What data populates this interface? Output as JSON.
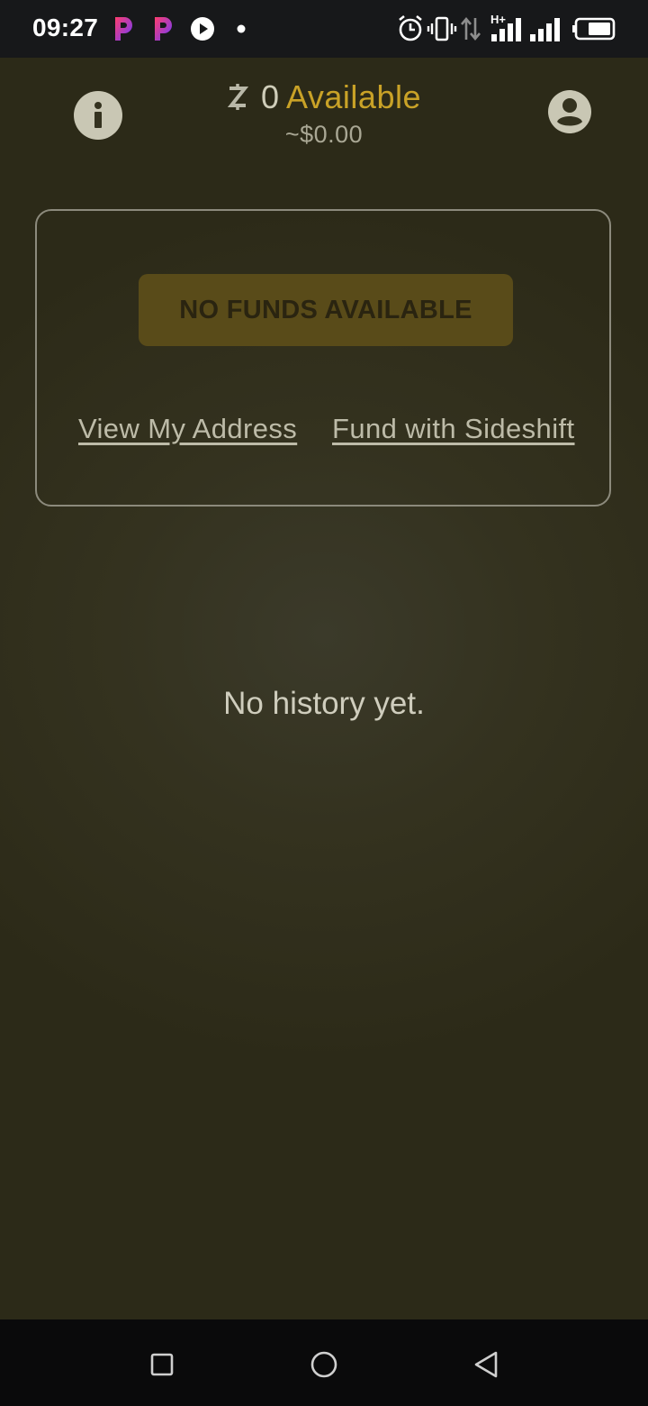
{
  "status_bar": {
    "time": "09:27",
    "network_label": "H+",
    "notification_icons": [
      "p-app-icon",
      "p-app-icon",
      "play-icon",
      "dot-icon"
    ],
    "system_icons": [
      "alarm-icon",
      "vibrate-icon",
      "data-arrows-icon",
      "signal-icon",
      "signal-icon",
      "battery-icon"
    ]
  },
  "header": {
    "currency_symbol": "ⓩ",
    "balance_amount": "0",
    "balance_label": "Available",
    "fiat_value": "~$0.00"
  },
  "funds_card": {
    "button_label": "NO FUNDS AVAILABLE",
    "view_address_link": "View My Address",
    "fund_sideshift_link": "Fund with Sideshift"
  },
  "history": {
    "empty_text": "No history yet."
  },
  "colors": {
    "accent": "#c9a227",
    "button_bg": "#594b19",
    "background": "#34321f"
  }
}
